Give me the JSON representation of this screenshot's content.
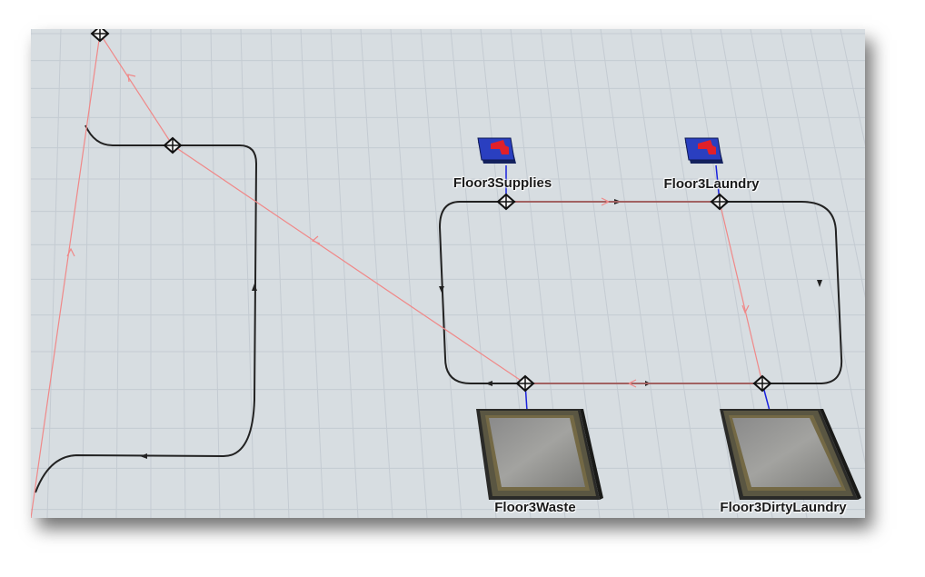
{
  "view": {
    "background": "#d7dde1",
    "grid_color": "#c4cbd2",
    "path_color": "#222222",
    "connector_color": "#f08888",
    "port_link_color": "#1a22dd"
  },
  "objects": {
    "floor3_supplies": {
      "label": "Floor3Supplies",
      "icon": "source-icon"
    },
    "floor3_laundry": {
      "label": "Floor3Laundry",
      "icon": "source-icon"
    },
    "floor3_waste": {
      "label": "Floor3Waste",
      "icon": "queue-platform-icon"
    },
    "floor3_dirty_laundry": {
      "label": "Floor3DirtyLaundry",
      "icon": "queue-platform-icon"
    }
  }
}
